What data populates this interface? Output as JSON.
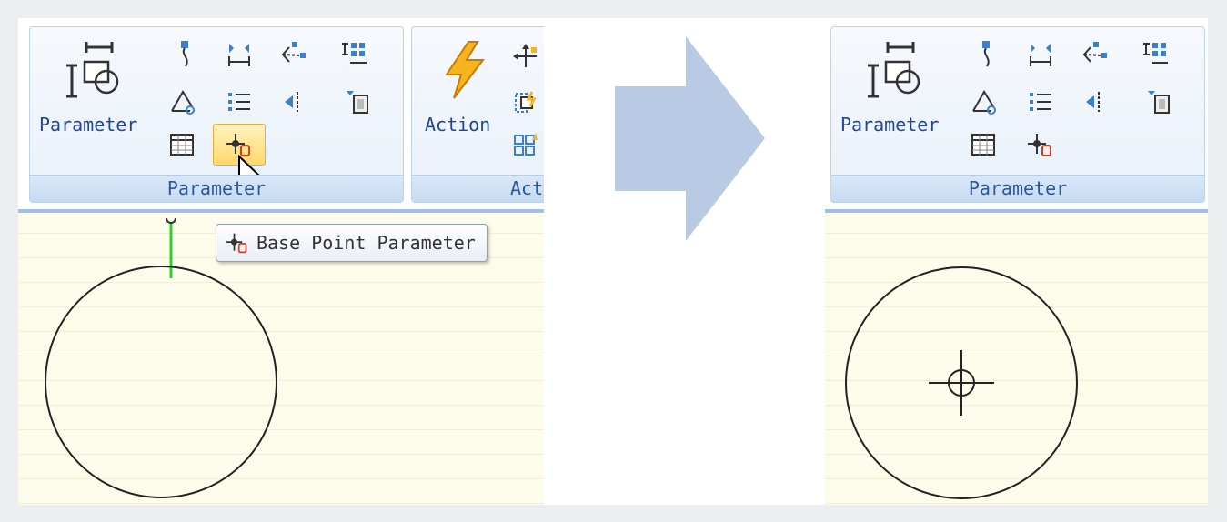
{
  "before": {
    "parameter_group": {
      "big_button_label": "Parameter",
      "footer_label": "Parameter"
    },
    "action_group": {
      "big_button_label": "Action",
      "footer_label": "Act"
    },
    "tooltip": {
      "text": "Base Point Parameter"
    }
  },
  "after": {
    "parameter_group": {
      "big_button_label": "Parameter",
      "footer_label": "Parameter"
    }
  },
  "colors": {
    "canvas": "#fdfbe9",
    "ribbon_text": "#22449c",
    "arrow": "#b9cbe4",
    "grip_line": "#33cc33",
    "highlight": "#ffd86a"
  }
}
